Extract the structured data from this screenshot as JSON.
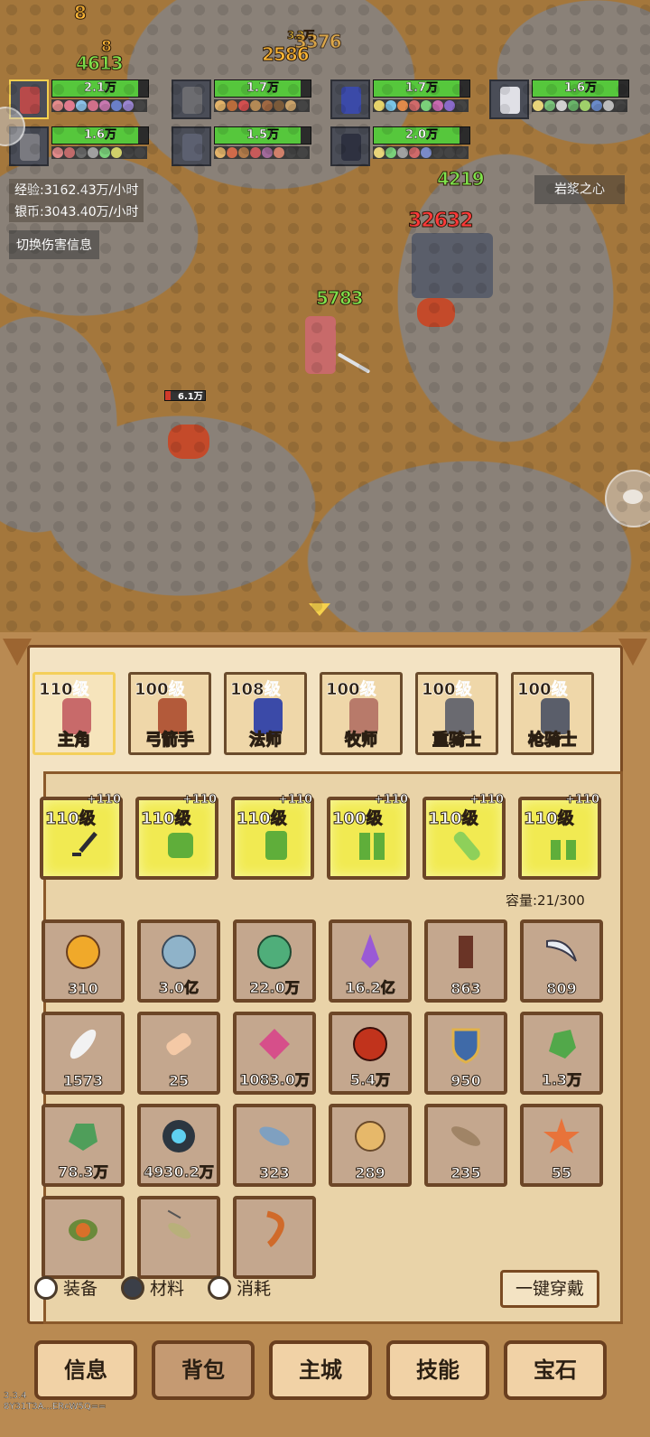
{
  "battle": {
    "damage_numbers": [
      "8",
      "8",
      "4613",
      "3.2万",
      "3376",
      "2586",
      "4219",
      "32632",
      "3232",
      "5783"
    ],
    "enemy_hp_label": "6.1万",
    "team_hp": [
      {
        "value": "2.1万",
        "fill": 0.9
      },
      {
        "value": "1.7万",
        "fill": 0.9
      },
      {
        "value": "1.7万",
        "fill": 0.9
      },
      {
        "value": "1.6万",
        "fill": 0.9
      },
      {
        "value": "1.6万",
        "fill": 0.9
      },
      {
        "value": "1.5万",
        "fill": 0.9
      },
      {
        "value": "2.0万",
        "fill": 0.9
      }
    ],
    "exp_rate": "经验:3162.43万/小时",
    "silver_rate": "银币:3043.40万/小时",
    "switch_button": "切换伤害信息",
    "map_name": "岩浆之心"
  },
  "team": [
    {
      "level": "110级",
      "name": "主角",
      "active": true
    },
    {
      "level": "100级",
      "name": "弓箭手",
      "active": false
    },
    {
      "level": "108级",
      "name": "法师",
      "active": false
    },
    {
      "level": "100级",
      "name": "牧师",
      "active": false
    },
    {
      "level": "100级",
      "name": "重骑士",
      "active": false
    },
    {
      "level": "100级",
      "name": "枪骑士",
      "active": false
    }
  ],
  "equipment": [
    {
      "level": "110级",
      "plus": "+110",
      "icon": "sword-icon"
    },
    {
      "level": "110级",
      "plus": "+110",
      "icon": "helmet-icon"
    },
    {
      "level": "110级",
      "plus": "+110",
      "icon": "chest-armor-icon"
    },
    {
      "level": "100级",
      "plus": "+110",
      "icon": "leg-armor-icon"
    },
    {
      "level": "110级",
      "plus": "+110",
      "icon": "bracer-icon"
    },
    {
      "level": "110级",
      "plus": "+110",
      "icon": "boots-icon"
    }
  ],
  "capacity": "容量:21/300",
  "items": [
    {
      "count": "310",
      "icon": "gold-coin-icon"
    },
    {
      "count": "3.0亿",
      "icon": "silver-coin-icon"
    },
    {
      "count": "22.0万",
      "icon": "green-orb-icon"
    },
    {
      "count": "16.2亿",
      "icon": "purple-crystal-icon"
    },
    {
      "count": "863",
      "icon": "wood-trunk-icon"
    },
    {
      "count": "809",
      "icon": "fang-icon"
    },
    {
      "count": "1573",
      "icon": "feather-icon"
    },
    {
      "count": "25",
      "icon": "scroll-icon"
    },
    {
      "count": "1083.0万",
      "icon": "pink-gem-icon"
    },
    {
      "count": "5.4万",
      "icon": "lava-orb-icon"
    },
    {
      "count": "950",
      "icon": "shield-icon"
    },
    {
      "count": "1.3万",
      "icon": "green-ore-icon"
    },
    {
      "count": "78.3万",
      "icon": "green-ore-icon"
    },
    {
      "count": "4930.2万",
      "icon": "blue-core-icon"
    },
    {
      "count": "323",
      "icon": "fish-icon"
    },
    {
      "count": "289",
      "icon": "pufferfish-icon"
    },
    {
      "count": "235",
      "icon": "catfish-icon"
    },
    {
      "count": "55",
      "icon": "starfish-icon"
    },
    {
      "count": "",
      "icon": "turtle-icon"
    },
    {
      "count": "",
      "icon": "swordfish-icon"
    },
    {
      "count": "",
      "icon": "shrimp-icon"
    }
  ],
  "filters": {
    "equipment": "装备",
    "materials": "材料",
    "consumables": "消耗"
  },
  "equip_all_button": "一键穿戴",
  "nav": {
    "info": "信息",
    "backpack": "背包",
    "main_city": "主城",
    "skills": "技能",
    "gems": "宝石"
  },
  "version": "3.3.4",
  "user_code": "8Y31T3A...ERcW5Q=="
}
